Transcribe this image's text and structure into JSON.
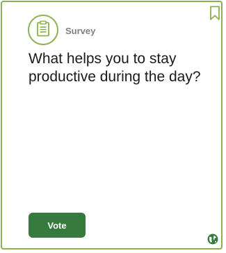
{
  "card": {
    "category": "Survey",
    "category_icon": "clipboard-icon",
    "question": "What helps you to stay productive during the day?",
    "vote_label": "Vote",
    "bookmark_icon": "bookmark-icon",
    "globe_icon": "globe-icon"
  },
  "colors": {
    "accent": "#8bb04f",
    "button": "#377a3e",
    "category_text": "#7f7f7f",
    "question_text": "#1a1a1a"
  }
}
